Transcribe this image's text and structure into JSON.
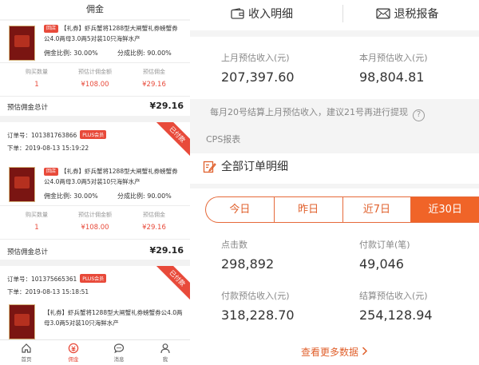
{
  "left": {
    "header_title": "佣金",
    "orders": [
      {
        "order_no": "",
        "order_time": "",
        "plus_badge": "",
        "status_ribbon": "",
        "product_tag": "回店",
        "product_title": "【礼券】虾兵蟹将1288型大闸蟹礼券螃蟹券公4.0两母3.0两5对装10只海鲜水产",
        "commission_rate_label": "佣金比例:",
        "commission_rate": "30.00%",
        "share_rate_label": "分成比例:",
        "share_rate": "90.00%",
        "stats": [
          {
            "label": "购买数量",
            "value": "1"
          },
          {
            "label": "预估计佣金额",
            "value": "¥108.00"
          },
          {
            "label": "预估佣金",
            "value": "¥29.16"
          }
        ],
        "total_label": "预估佣金总计",
        "total_value": "¥29.16"
      },
      {
        "order_no": "订单号：101381763866",
        "order_time": "下单：2019-08-13 15:19:22",
        "plus_badge": "PLUS会员",
        "status_ribbon": "已付款",
        "product_tag": "回店",
        "product_title": "【礼券】虾兵蟹将1288型大闸蟹礼券螃蟹券公4.0两母3.0两5对装10只海鲜水产",
        "commission_rate_label": "佣金比例:",
        "commission_rate": "30.00%",
        "share_rate_label": "分成比例:",
        "share_rate": "90.00%",
        "stats": [
          {
            "label": "购买数量",
            "value": "1"
          },
          {
            "label": "预估计佣金额",
            "value": "¥108.00"
          },
          {
            "label": "预估佣金",
            "value": "¥29.16"
          }
        ],
        "total_label": "预估佣金总计",
        "total_value": "¥29.16"
      },
      {
        "order_no": "订单号：101375665361",
        "order_time": "下单：2019-08-13 15:18:51",
        "plus_badge": "PLUS会员",
        "status_ribbon": "已付款",
        "product_tag": "",
        "product_title": "【礼券】虾兵蟹将1288型大闸蟹礼券螃蟹券公4.0两母3.0两5对装10只海鲜水产",
        "commission_rate_label": "",
        "commission_rate": "",
        "share_rate_label": "",
        "share_rate": "",
        "stats": [],
        "total_label": "",
        "total_value": ""
      }
    ],
    "nav": [
      {
        "label": "首页",
        "icon": "home-icon"
      },
      {
        "label": "佣金",
        "icon": "commission-icon",
        "active": true
      },
      {
        "label": "消息",
        "icon": "message-icon"
      },
      {
        "label": "我",
        "icon": "user-icon"
      }
    ]
  },
  "right": {
    "income_detail_label": "收入明细",
    "tax_report_label": "退税报备",
    "last_month_label": "上月预估收入(元)",
    "last_month_value": "207,397.60",
    "this_month_label": "本月预估收入(元)",
    "this_month_value": "98,804.81",
    "hint_text": "每月20号结算上月预估收入，建议21号再进行提现",
    "cps_label": "CPS报表",
    "all_orders_label": "全部订单明细",
    "tabs": [
      {
        "label": "今日",
        "active": false
      },
      {
        "label": "昨日",
        "active": false
      },
      {
        "label": "近7日",
        "active": false
      },
      {
        "label": "近30日",
        "active": true
      }
    ],
    "clicks_label": "点击数",
    "clicks_value": "298,892",
    "paid_orders_label": "付款订单(笔)",
    "paid_orders_value": "49,046",
    "paid_income_label": "付款预估收入(元)",
    "paid_income_value": "318,228.70",
    "settled_income_label": "结算预估收入(元)",
    "settled_income_value": "254,128.94",
    "more_label": "查看更多数据"
  },
  "colors": {
    "accent": "#e84a3a",
    "tab_active": "#f06428",
    "tab_text": "#e0602c"
  }
}
